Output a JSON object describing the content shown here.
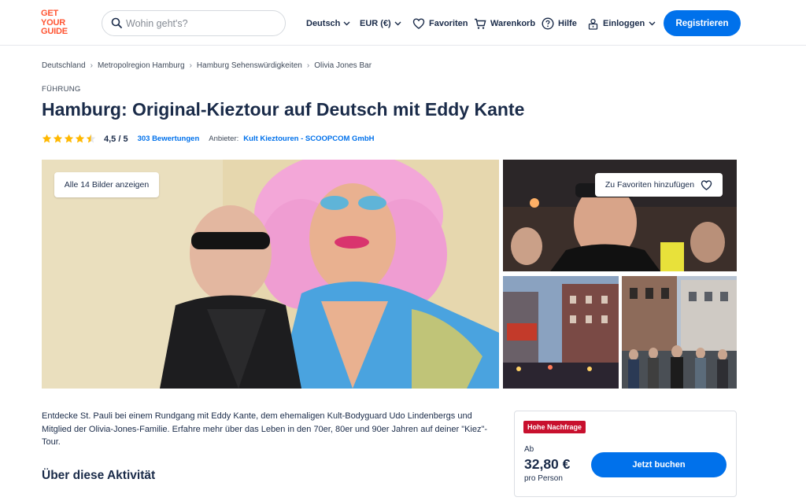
{
  "header": {
    "logo_line1": "GET",
    "logo_line2": "YOUR",
    "logo_line3": "GUIDE",
    "search_placeholder": "Wohin geht's?",
    "language": "Deutsch",
    "currency": "EUR (€)",
    "favorites": "Favoriten",
    "cart": "Warenkorb",
    "help": "Hilfe",
    "login": "Einloggen",
    "register": "Registrieren",
    "brand_color": "#ff5533",
    "accent_color": "#0071eb"
  },
  "breadcrumbs": [
    "Deutschland",
    "Metropolregion Hamburg",
    "Hamburg Sehenswürdigkeiten",
    "Olivia Jones Bar"
  ],
  "category": "FÜHRUNG",
  "title": "Hamburg: Original-Kieztour auf Deutsch mit Eddy Kante",
  "rating": {
    "stars": 4.5,
    "score": "4,5 / 5",
    "reviews": "303 Bewertungen",
    "provider_label": "Anbieter:",
    "provider": "Kult Kieztouren - SCOOPCOM GmbH"
  },
  "gallery": {
    "show_all": "Alle 14 Bilder anzeigen",
    "add_favorite": "Zu Favoriten hinzufügen"
  },
  "description": "Entdecke St. Pauli bei einem Rundgang mit Eddy Kante, dem ehemaligen Kult-Bodyguard Udo Lindenbergs und Mitglied der Olivia-Jones-Familie. Erfahre mehr über das Leben in den 70er, 80er und 90er Jahren auf deiner \"Kiez\"-Tour.",
  "about_heading": "Über diese Aktivität",
  "booking": {
    "badge": "Hohe Nachfrage",
    "from": "Ab",
    "price": "32,80 €",
    "per_person": "pro Person",
    "book_button": "Jetzt buchen"
  }
}
